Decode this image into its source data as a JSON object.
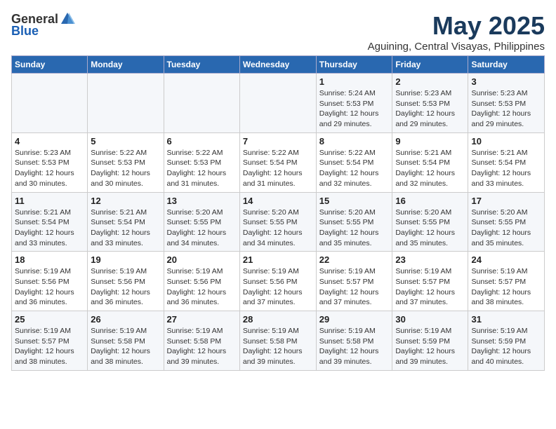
{
  "logo": {
    "general": "General",
    "blue": "Blue"
  },
  "title": "May 2025",
  "location": "Aguining, Central Visayas, Philippines",
  "days_of_week": [
    "Sunday",
    "Monday",
    "Tuesday",
    "Wednesday",
    "Thursday",
    "Friday",
    "Saturday"
  ],
  "weeks": [
    [
      {
        "day": "",
        "sunrise": "",
        "sunset": "",
        "daylight": ""
      },
      {
        "day": "",
        "sunrise": "",
        "sunset": "",
        "daylight": ""
      },
      {
        "day": "",
        "sunrise": "",
        "sunset": "",
        "daylight": ""
      },
      {
        "day": "",
        "sunrise": "",
        "sunset": "",
        "daylight": ""
      },
      {
        "day": "1",
        "sunrise": "Sunrise: 5:24 AM",
        "sunset": "Sunset: 5:53 PM",
        "daylight": "Daylight: 12 hours and 29 minutes."
      },
      {
        "day": "2",
        "sunrise": "Sunrise: 5:23 AM",
        "sunset": "Sunset: 5:53 PM",
        "daylight": "Daylight: 12 hours and 29 minutes."
      },
      {
        "day": "3",
        "sunrise": "Sunrise: 5:23 AM",
        "sunset": "Sunset: 5:53 PM",
        "daylight": "Daylight: 12 hours and 29 minutes."
      }
    ],
    [
      {
        "day": "4",
        "sunrise": "Sunrise: 5:23 AM",
        "sunset": "Sunset: 5:53 PM",
        "daylight": "Daylight: 12 hours and 30 minutes."
      },
      {
        "day": "5",
        "sunrise": "Sunrise: 5:22 AM",
        "sunset": "Sunset: 5:53 PM",
        "daylight": "Daylight: 12 hours and 30 minutes."
      },
      {
        "day": "6",
        "sunrise": "Sunrise: 5:22 AM",
        "sunset": "Sunset: 5:53 PM",
        "daylight": "Daylight: 12 hours and 31 minutes."
      },
      {
        "day": "7",
        "sunrise": "Sunrise: 5:22 AM",
        "sunset": "Sunset: 5:54 PM",
        "daylight": "Daylight: 12 hours and 31 minutes."
      },
      {
        "day": "8",
        "sunrise": "Sunrise: 5:22 AM",
        "sunset": "Sunset: 5:54 PM",
        "daylight": "Daylight: 12 hours and 32 minutes."
      },
      {
        "day": "9",
        "sunrise": "Sunrise: 5:21 AM",
        "sunset": "Sunset: 5:54 PM",
        "daylight": "Daylight: 12 hours and 32 minutes."
      },
      {
        "day": "10",
        "sunrise": "Sunrise: 5:21 AM",
        "sunset": "Sunset: 5:54 PM",
        "daylight": "Daylight: 12 hours and 33 minutes."
      }
    ],
    [
      {
        "day": "11",
        "sunrise": "Sunrise: 5:21 AM",
        "sunset": "Sunset: 5:54 PM",
        "daylight": "Daylight: 12 hours and 33 minutes."
      },
      {
        "day": "12",
        "sunrise": "Sunrise: 5:21 AM",
        "sunset": "Sunset: 5:54 PM",
        "daylight": "Daylight: 12 hours and 33 minutes."
      },
      {
        "day": "13",
        "sunrise": "Sunrise: 5:20 AM",
        "sunset": "Sunset: 5:55 PM",
        "daylight": "Daylight: 12 hours and 34 minutes."
      },
      {
        "day": "14",
        "sunrise": "Sunrise: 5:20 AM",
        "sunset": "Sunset: 5:55 PM",
        "daylight": "Daylight: 12 hours and 34 minutes."
      },
      {
        "day": "15",
        "sunrise": "Sunrise: 5:20 AM",
        "sunset": "Sunset: 5:55 PM",
        "daylight": "Daylight: 12 hours and 35 minutes."
      },
      {
        "day": "16",
        "sunrise": "Sunrise: 5:20 AM",
        "sunset": "Sunset: 5:55 PM",
        "daylight": "Daylight: 12 hours and 35 minutes."
      },
      {
        "day": "17",
        "sunrise": "Sunrise: 5:20 AM",
        "sunset": "Sunset: 5:55 PM",
        "daylight": "Daylight: 12 hours and 35 minutes."
      }
    ],
    [
      {
        "day": "18",
        "sunrise": "Sunrise: 5:19 AM",
        "sunset": "Sunset: 5:56 PM",
        "daylight": "Daylight: 12 hours and 36 minutes."
      },
      {
        "day": "19",
        "sunrise": "Sunrise: 5:19 AM",
        "sunset": "Sunset: 5:56 PM",
        "daylight": "Daylight: 12 hours and 36 minutes."
      },
      {
        "day": "20",
        "sunrise": "Sunrise: 5:19 AM",
        "sunset": "Sunset: 5:56 PM",
        "daylight": "Daylight: 12 hours and 36 minutes."
      },
      {
        "day": "21",
        "sunrise": "Sunrise: 5:19 AM",
        "sunset": "Sunset: 5:56 PM",
        "daylight": "Daylight: 12 hours and 37 minutes."
      },
      {
        "day": "22",
        "sunrise": "Sunrise: 5:19 AM",
        "sunset": "Sunset: 5:57 PM",
        "daylight": "Daylight: 12 hours and 37 minutes."
      },
      {
        "day": "23",
        "sunrise": "Sunrise: 5:19 AM",
        "sunset": "Sunset: 5:57 PM",
        "daylight": "Daylight: 12 hours and 37 minutes."
      },
      {
        "day": "24",
        "sunrise": "Sunrise: 5:19 AM",
        "sunset": "Sunset: 5:57 PM",
        "daylight": "Daylight: 12 hours and 38 minutes."
      }
    ],
    [
      {
        "day": "25",
        "sunrise": "Sunrise: 5:19 AM",
        "sunset": "Sunset: 5:57 PM",
        "daylight": "Daylight: 12 hours and 38 minutes."
      },
      {
        "day": "26",
        "sunrise": "Sunrise: 5:19 AM",
        "sunset": "Sunset: 5:58 PM",
        "daylight": "Daylight: 12 hours and 38 minutes."
      },
      {
        "day": "27",
        "sunrise": "Sunrise: 5:19 AM",
        "sunset": "Sunset: 5:58 PM",
        "daylight": "Daylight: 12 hours and 39 minutes."
      },
      {
        "day": "28",
        "sunrise": "Sunrise: 5:19 AM",
        "sunset": "Sunset: 5:58 PM",
        "daylight": "Daylight: 12 hours and 39 minutes."
      },
      {
        "day": "29",
        "sunrise": "Sunrise: 5:19 AM",
        "sunset": "Sunset: 5:58 PM",
        "daylight": "Daylight: 12 hours and 39 minutes."
      },
      {
        "day": "30",
        "sunrise": "Sunrise: 5:19 AM",
        "sunset": "Sunset: 5:59 PM",
        "daylight": "Daylight: 12 hours and 39 minutes."
      },
      {
        "day": "31",
        "sunrise": "Sunrise: 5:19 AM",
        "sunset": "Sunset: 5:59 PM",
        "daylight": "Daylight: 12 hours and 40 minutes."
      }
    ]
  ]
}
